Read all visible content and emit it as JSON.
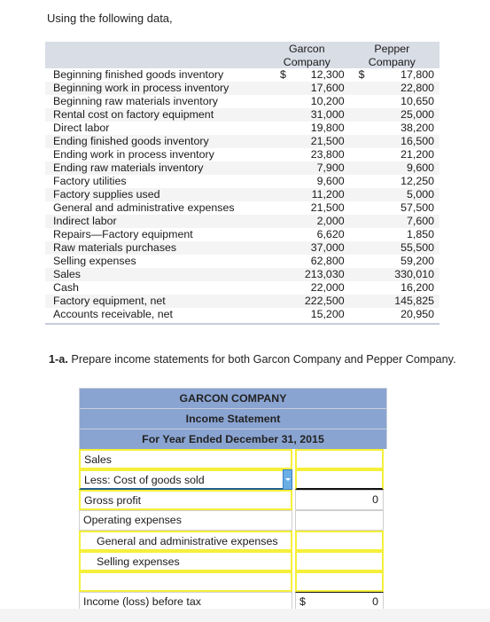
{
  "intro_text": "Using the following data,",
  "data_table": {
    "headers": {
      "garcon": [
        "Garcon",
        "Company"
      ],
      "pepper": [
        "Pepper",
        "Company"
      ]
    },
    "currency_symbol": "$",
    "rows": [
      {
        "label": "Beginning finished goods inventory",
        "garcon": "12,300",
        "pepper": "17,800"
      },
      {
        "label": "Beginning work in process inventory",
        "garcon": "17,600",
        "pepper": "22,800"
      },
      {
        "label": "Beginning raw materials inventory",
        "garcon": "10,200",
        "pepper": "10,650"
      },
      {
        "label": "Rental cost on factory equipment",
        "garcon": "31,000",
        "pepper": "25,000"
      },
      {
        "label": "Direct labor",
        "garcon": "19,800",
        "pepper": "38,200"
      },
      {
        "label": "Ending finished goods inventory",
        "garcon": "21,500",
        "pepper": "16,500"
      },
      {
        "label": "Ending work in process inventory",
        "garcon": "23,800",
        "pepper": "21,200"
      },
      {
        "label": "Ending raw materials inventory",
        "garcon": "7,900",
        "pepper": "9,600"
      },
      {
        "label": "Factory utilities",
        "garcon": "9,600",
        "pepper": "12,250"
      },
      {
        "label": "Factory supplies used",
        "garcon": "11,200",
        "pepper": "5,000"
      },
      {
        "label": "General and administrative expenses",
        "garcon": "21,500",
        "pepper": "57,500"
      },
      {
        "label": "Indirect labor",
        "garcon": "2,000",
        "pepper": "7,600"
      },
      {
        "label": "Repairs—Factory equipment",
        "garcon": "6,620",
        "pepper": "1,850"
      },
      {
        "label": "Raw materials purchases",
        "garcon": "37,000",
        "pepper": "55,500"
      },
      {
        "label": "Selling expenses",
        "garcon": "62,800",
        "pepper": "59,200"
      },
      {
        "label": "Sales",
        "garcon": "213,030",
        "pepper": "330,010"
      },
      {
        "label": "Cash",
        "garcon": "22,000",
        "pepper": "16,200"
      },
      {
        "label": "Factory equipment, net",
        "garcon": "222,500",
        "pepper": "145,825"
      },
      {
        "label": "Accounts receivable, net",
        "garcon": "15,200",
        "pepper": "20,950"
      }
    ]
  },
  "question": {
    "number": "1-a.",
    "text": "Prepare income statements for both Garcon Company and Pepper Company."
  },
  "income_statement": {
    "company": "GARCON COMPANY",
    "title": "Income Statement",
    "period": "For Year Ended December 31, 2015",
    "rows": {
      "sales": {
        "label": "Sales",
        "value": ""
      },
      "cogs": {
        "label": "Less: Cost of goods sold",
        "value": "",
        "dropdown_icon": "chevron-down-icon"
      },
      "gross_profit": {
        "label": "Gross profit",
        "value": "0"
      },
      "operating_expenses": {
        "label": "Operating expenses",
        "value": ""
      },
      "gen_admin": {
        "label": "General and administrative expenses",
        "value": ""
      },
      "selling": {
        "label": "Selling expenses",
        "value": ""
      },
      "blank": {
        "label": "",
        "value": ""
      },
      "income_before_tax": {
        "label": "Income (loss) before tax",
        "currency": "$",
        "value": "0"
      }
    }
  },
  "colors": {
    "header_blue": "#8aa4d2",
    "input_yellow": "#f5ef3a",
    "dropdown_blue": "#6aaee6",
    "data_header_gray": "#d9dde6"
  }
}
